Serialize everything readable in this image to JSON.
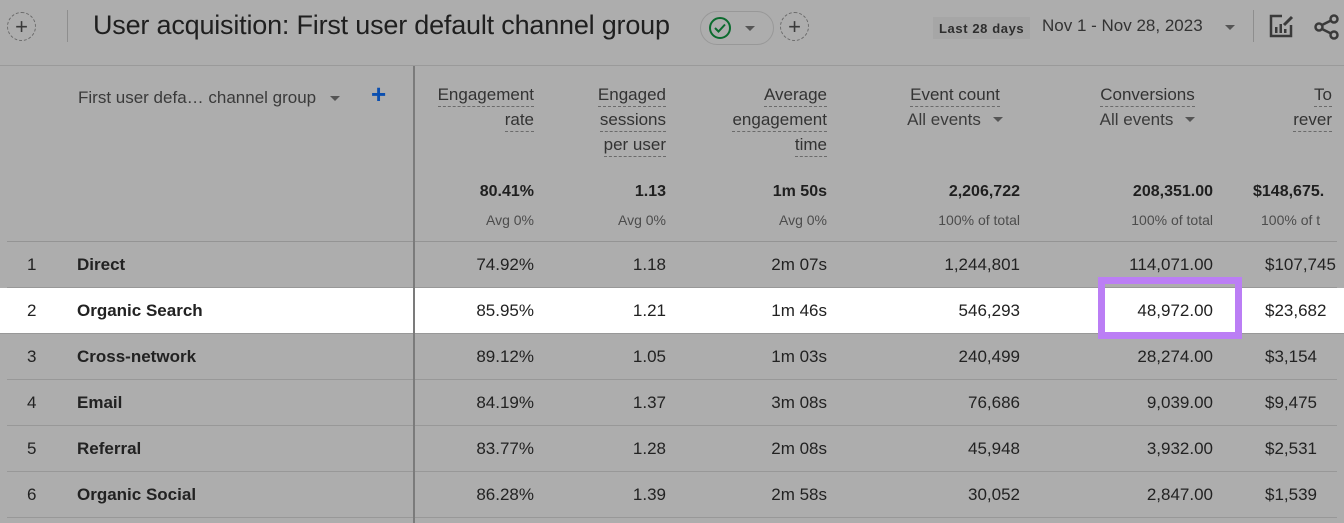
{
  "header": {
    "title": "User acquisition: First user default channel group",
    "date_preset": "Last 28 days",
    "date_range": "Nov 1 - Nov 28, 2023",
    "icons": [
      "add-comparison-icon",
      "check-circle-icon",
      "chevron-down-icon",
      "add-icon",
      "edit-report-icon",
      "share-icon"
    ]
  },
  "table": {
    "dimension_header": "First user defa… channel group",
    "columns": [
      {
        "key": "engagement_rate",
        "lines": [
          "Engagement",
          "rate"
        ],
        "total": "80.41%",
        "total_sub": "Avg 0%"
      },
      {
        "key": "engaged_sessions",
        "lines": [
          "Engaged",
          "sessions",
          "per user"
        ],
        "total": "1.13",
        "total_sub": "Avg 0%"
      },
      {
        "key": "avg_engagement_time",
        "lines": [
          "Average",
          "engagement",
          "time"
        ],
        "total": "1m 50s",
        "total_sub": "Avg 0%"
      },
      {
        "key": "event_count",
        "lines": [
          "Event count"
        ],
        "selector": "All events",
        "total": "2,206,722",
        "total_sub": "100% of total"
      },
      {
        "key": "conversions",
        "lines": [
          "Conversions"
        ],
        "selector": "All events",
        "total": "208,351.00",
        "total_sub": "100% of total"
      },
      {
        "key": "total_revenue",
        "lines": [
          "To",
          "rever"
        ],
        "total": "$148,675.",
        "total_sub": "100% of t"
      }
    ],
    "rows": [
      {
        "index": "1",
        "channel": "Direct",
        "values": [
          "74.92%",
          "1.18",
          "2m 07s",
          "1,244,801",
          "114,071.00",
          "$107,745"
        ]
      },
      {
        "index": "2",
        "channel": "Organic Search",
        "values": [
          "85.95%",
          "1.21",
          "1m 46s",
          "546,293",
          "48,972.00",
          "$23,682"
        ],
        "highlighted": true
      },
      {
        "index": "3",
        "channel": "Cross-network",
        "values": [
          "89.12%",
          "1.05",
          "1m 03s",
          "240,499",
          "28,274.00",
          "$3,154"
        ]
      },
      {
        "index": "4",
        "channel": "Email",
        "values": [
          "84.19%",
          "1.37",
          "3m 08s",
          "76,686",
          "9,039.00",
          "$9,475"
        ]
      },
      {
        "index": "5",
        "channel": "Referral",
        "values": [
          "83.77%",
          "1.28",
          "2m 08s",
          "45,948",
          "3,932.00",
          "$2,531"
        ]
      },
      {
        "index": "6",
        "channel": "Organic Social",
        "values": [
          "86.28%",
          "1.39",
          "2m 58s",
          "30,052",
          "2,847.00",
          "$1,539"
        ]
      }
    ]
  },
  "colors": {
    "overlay_bg": "#adadad",
    "highlight_row_bg": "#ffffff",
    "highlight_box": "#bb7ef5",
    "accent_blue": "#0b4fb0",
    "check_green": "#0b6b2e"
  }
}
